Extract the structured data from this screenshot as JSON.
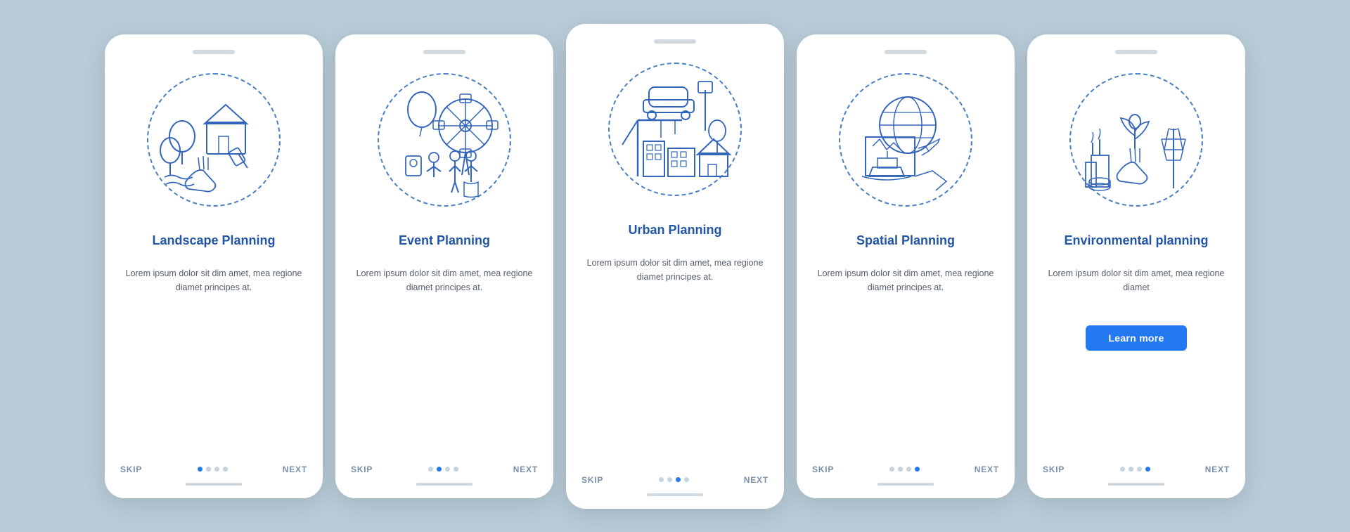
{
  "cards": [
    {
      "id": "landscape",
      "title": "Landscape\nPlanning",
      "body": "Lorem ipsum dolor sit dim amet, mea regione diamet principes at.",
      "dots": [
        false,
        false,
        false,
        false
      ],
      "activeDot": 0,
      "showLearnMore": false,
      "skip": "SKIP",
      "next": "NEXT"
    },
    {
      "id": "event",
      "title": "Event\nPlanning",
      "body": "Lorem ipsum dolor sit dim amet, mea regione diamet principes at.",
      "dots": [
        false,
        false,
        false,
        false
      ],
      "activeDot": 1,
      "showLearnMore": false,
      "skip": "SKIP",
      "next": "NEXT"
    },
    {
      "id": "urban",
      "title": "Urban\nPlanning",
      "body": "Lorem ipsum dolor sit dim amet, mea regione diamet principes at.",
      "dots": [
        false,
        false,
        false,
        false
      ],
      "activeDot": 2,
      "showLearnMore": false,
      "skip": "SKIP",
      "next": "NEXT"
    },
    {
      "id": "spatial",
      "title": "Spatial\nPlanning",
      "body": "Lorem ipsum dolor sit dim amet, mea regione diamet principes at.",
      "dots": [
        false,
        false,
        false,
        false
      ],
      "activeDot": 3,
      "showLearnMore": false,
      "skip": "SKIP",
      "next": "NEXT"
    },
    {
      "id": "environmental",
      "title": "Environmental\nplanning",
      "body": "Lorem ipsum dolor sit dim amet, mea regione diamet",
      "dots": [
        false,
        false,
        false,
        false
      ],
      "activeDot": 4,
      "showLearnMore": true,
      "learnMoreLabel": "Learn more",
      "skip": "SKIP",
      "next": "NEXT"
    }
  ]
}
